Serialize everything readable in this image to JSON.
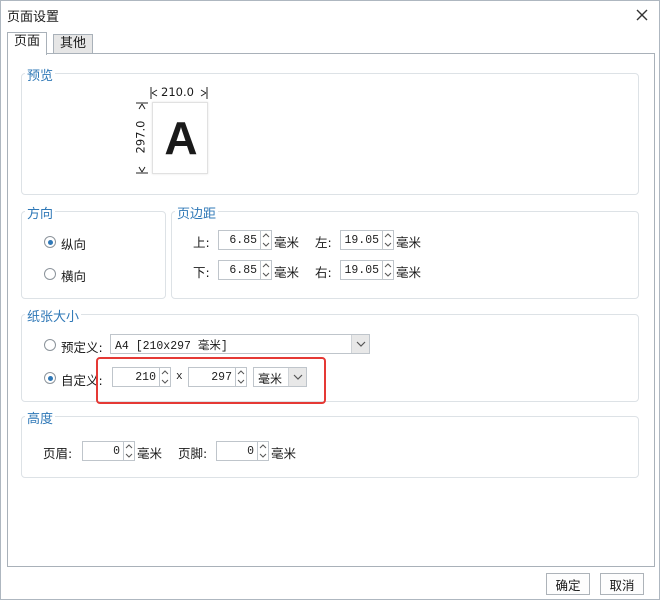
{
  "window": {
    "title": "页面设置"
  },
  "tabs": [
    {
      "label": "页面",
      "active": true
    },
    {
      "label": "其他",
      "active": false
    }
  ],
  "preview": {
    "title": "预览",
    "width_label": "210.0",
    "height_label": "297.0",
    "letter": "A"
  },
  "orientation": {
    "title": "方向",
    "portrait": "纵向",
    "landscape": "横向",
    "selected": "portrait"
  },
  "margins": {
    "title": "页边距",
    "top_label": "上:",
    "top_value": "6.85",
    "left_label": "左:",
    "left_value": "19.05",
    "bottom_label": "下:",
    "bottom_value": "6.85",
    "right_label": "右:",
    "right_value": "19.05",
    "unit": "毫米"
  },
  "paper": {
    "title": "纸张大小",
    "predefined_label": "预定义:",
    "predefined_value": "A4 [210x297 毫米]",
    "custom_label": "自定义:",
    "width": "210",
    "x": "x",
    "height": "297",
    "unit": "毫米",
    "selected": "custom"
  },
  "height": {
    "title": "高度",
    "header_label": "页眉:",
    "header_value": "0",
    "footer_label": "页脚:",
    "footer_value": "0",
    "unit": "毫米"
  },
  "buttons": {
    "ok": "确定",
    "cancel": "取消"
  },
  "colors": {
    "accent": "#2f78b7",
    "highlight": "#e53935"
  }
}
